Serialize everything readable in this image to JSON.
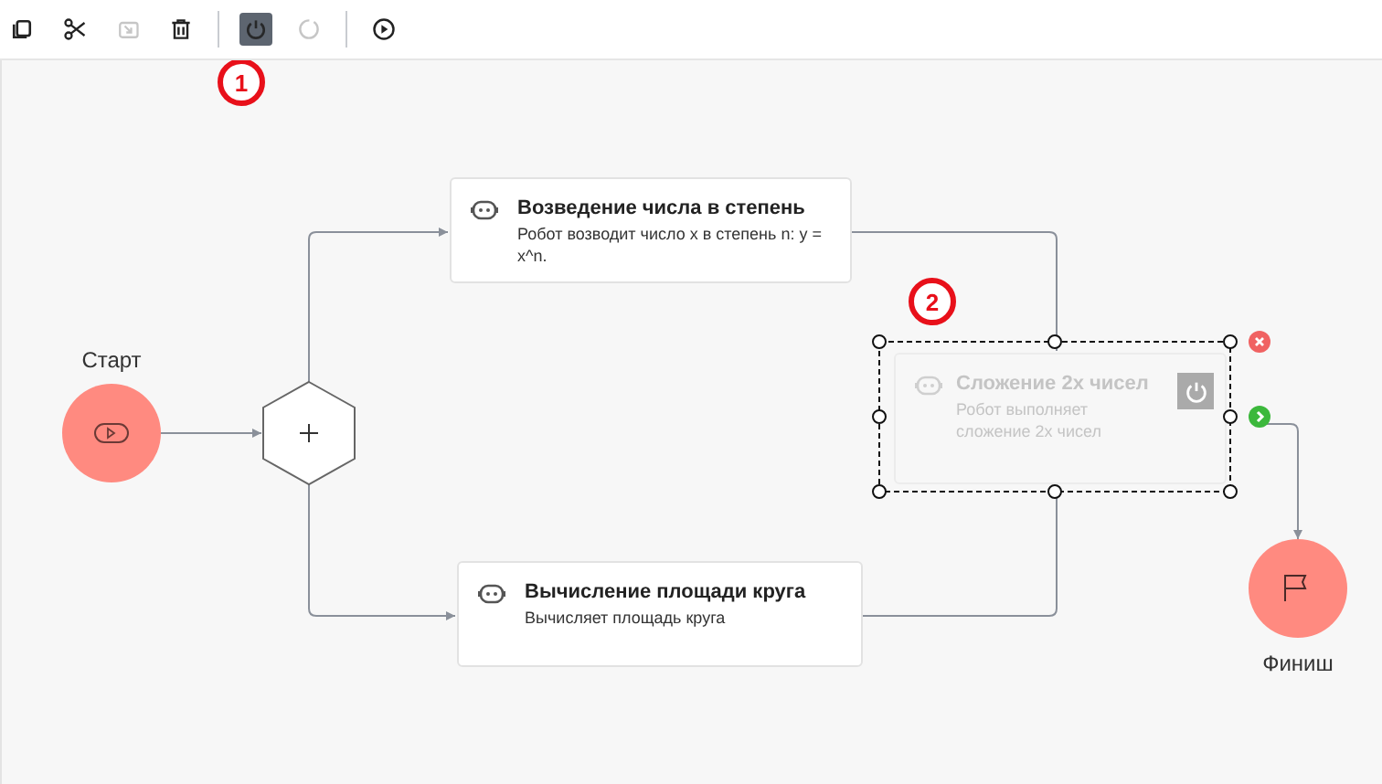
{
  "toolbar": {
    "buttons": [
      {
        "kind": "copy",
        "disabled": false,
        "selected": false
      },
      {
        "kind": "cut",
        "disabled": false,
        "selected": false
      },
      {
        "kind": "paste",
        "disabled": true,
        "selected": false
      },
      {
        "kind": "delete",
        "disabled": false,
        "selected": false
      },
      {
        "kind": "separator"
      },
      {
        "kind": "power",
        "disabled": false,
        "selected": true
      },
      {
        "kind": "refresh",
        "disabled": true,
        "selected": false
      },
      {
        "kind": "separator"
      },
      {
        "kind": "run",
        "disabled": false,
        "selected": false
      }
    ]
  },
  "annotations": [
    {
      "label": "1"
    },
    {
      "label": "2"
    }
  ],
  "start": {
    "label": "Старт"
  },
  "finish": {
    "label": "Финиш"
  },
  "tasks": [
    {
      "title": "Возведение числа в степень",
      "description": "Робот возводит число x в степень n: y = x^n.",
      "disabled": false,
      "selected": false
    },
    {
      "title": "Сложение 2х чисел",
      "description": "Робот выполняет сложение 2х чисел",
      "disabled": true,
      "selected": true
    },
    {
      "title": "Вычисление площади круга",
      "description": "Вычисляет площадь круга",
      "disabled": false,
      "selected": false
    }
  ]
}
